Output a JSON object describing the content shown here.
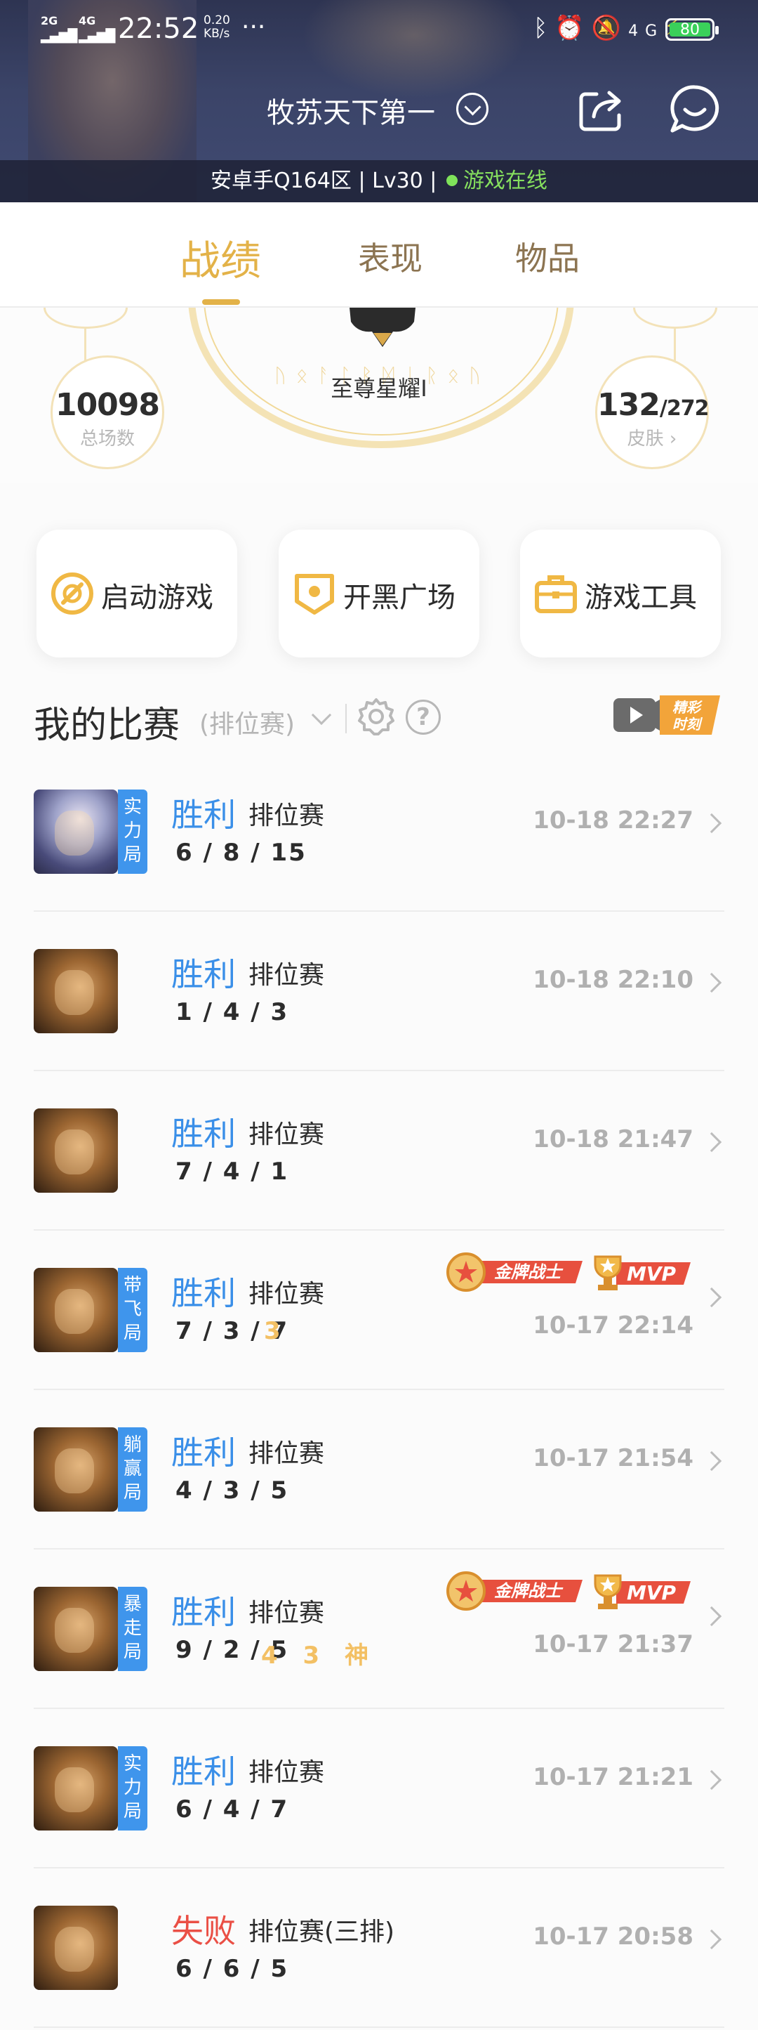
{
  "status_bar": {
    "sim1": "2G",
    "sim2": "4G",
    "time": "22:52",
    "net_speed": "0.20",
    "net_unit": "KB/s",
    "battery": "80"
  },
  "header": {
    "nickname": "牧苏天下第一",
    "server_info": "安卓手Q164区 | Lv30 |",
    "online_status": "游戏在线"
  },
  "tabs": [
    {
      "label": "战绩",
      "active": true
    },
    {
      "label": "表现",
      "active": false
    },
    {
      "label": "物品",
      "active": false
    }
  ],
  "rank": {
    "name": "至尊星耀Ⅰ",
    "total_matches": "10098",
    "total_matches_label": "总场数",
    "skins_owned": "132",
    "skins_total": "/272",
    "skins_label": "皮肤"
  },
  "quick_actions": [
    {
      "label": "启动游戏",
      "icon": "launch-game-icon"
    },
    {
      "label": "开黑广场",
      "icon": "team-square-icon"
    },
    {
      "label": "游戏工具",
      "icon": "toolbox-icon"
    }
  ],
  "matches_section": {
    "title": "我的比赛",
    "filter": "(排位赛)",
    "highlight_badge_line1": "精彩",
    "highlight_badge_line2": "时刻"
  },
  "matches": [
    {
      "result": "胜利",
      "type": "排位赛",
      "kda": "6 / 8 / 15",
      "time": "10-18 22:27",
      "tag": "实力局",
      "avatar": "silver-hero",
      "extras": "",
      "gold_medal": "",
      "mvp": "",
      "lose": false
    },
    {
      "result": "胜利",
      "type": "排位赛",
      "kda": "1 / 4 / 3",
      "time": "10-18 22:10",
      "tag": "",
      "avatar": "gold-hero",
      "extras": "",
      "gold_medal": "",
      "mvp": "",
      "lose": false
    },
    {
      "result": "胜利",
      "type": "排位赛",
      "kda": "7 / 4 / 1",
      "time": "10-18 21:47",
      "tag": "",
      "avatar": "gold-hero",
      "extras": "",
      "gold_medal": "",
      "mvp": "",
      "lose": false
    },
    {
      "result": "胜利",
      "type": "排位赛",
      "kda": "7 / 3 / 7",
      "time": "10-17 22:14",
      "tag": "带飞局",
      "avatar": "gold-hero",
      "extras": "3",
      "gold_medal": "金牌战士",
      "mvp": "MVP",
      "lose": false
    },
    {
      "result": "胜利",
      "type": "排位赛",
      "kda": "4 / 3 / 5",
      "time": "10-17 21:54",
      "tag": "躺赢局",
      "avatar": "gold-hero",
      "extras": "",
      "gold_medal": "",
      "mvp": "",
      "lose": false
    },
    {
      "result": "胜利",
      "type": "排位赛",
      "kda": "9 / 2 / 5",
      "time": "10-17 21:37",
      "tag": "暴走局",
      "avatar": "gold-hero",
      "extras": "4 3 神",
      "gold_medal": "金牌战士",
      "mvp": "MVP",
      "lose": false
    },
    {
      "result": "胜利",
      "type": "排位赛",
      "kda": "6 / 4 / 7",
      "time": "10-17 21:21",
      "tag": "实力局",
      "avatar": "gold-hero",
      "extras": "",
      "gold_medal": "",
      "mvp": "",
      "lose": false
    },
    {
      "result": "失败",
      "type": "排位赛(三排)",
      "kda": "6 / 6 / 5",
      "time": "10-17 20:58",
      "tag": "",
      "avatar": "gold-hero",
      "extras": "",
      "gold_medal": "",
      "mvp": "",
      "lose": true
    }
  ],
  "colors": {
    "accent_gold": "#e3b248",
    "win_blue": "#3a8fe8",
    "lose_red": "#ea4f45",
    "tag_blue": "#3f95ec",
    "online_green": "#86e05e"
  }
}
